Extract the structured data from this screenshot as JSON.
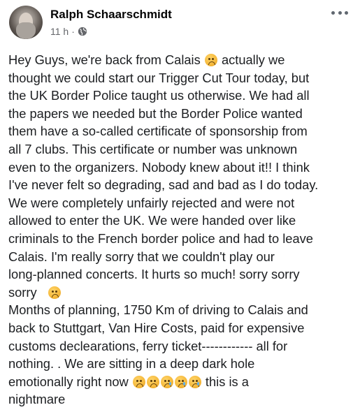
{
  "author": {
    "name": "Ralph Schaarschmidt",
    "time": "11 h",
    "separator": "·"
  },
  "icons": {
    "avatar": "profile-photo",
    "globe": "public-globe-icon",
    "more": "more-options-icon"
  },
  "post_lines": [
    "Hey Guys, we're back from Calais",
    "actually we",
    "thought we could start our Trigger Cut Tour today, but",
    "the UK Border Police taught us otherwise. We had all",
    "the papers we needed but the Border Police wanted",
    "them have a so-called certificate of sponsorship from",
    "all 7 clubs. This certificate or number was unknown",
    "even to the organizers. Nobody knew about it!! I think",
    "I've never felt so degrading, sad and bad as I do today.",
    "We were completely unfairly rejected and were not",
    "allowed to enter the UK. We were handed over like",
    "criminals to the French border police and had to leave",
    "Calais. I'm really sorry that we couldn't play our",
    "long-planned concerts. It hurts so much!  sorry sorry",
    "sorry",
    "Months of planning, 1750 Km of driving to Calais and",
    "back to Stuttgart, Van Hire Costs, paid for expensive",
    "customs declearations, ferry ticket------------ all for",
    "nothing. .  We are sitting in a deep dark hole",
    "emotionally right now",
    "this is a",
    "nightmare"
  ],
  "colors": {
    "name": "#050505",
    "meta": "#65676b",
    "text": "#1c1e21"
  }
}
